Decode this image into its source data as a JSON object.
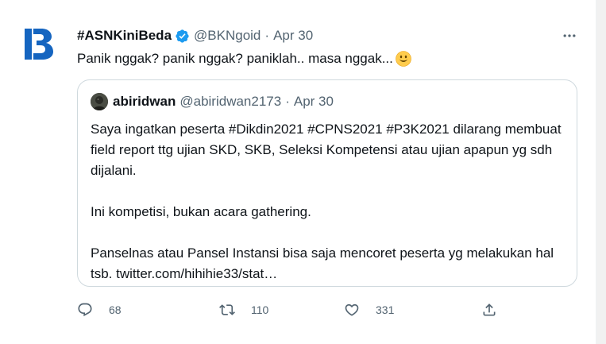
{
  "tweet": {
    "author_name": "#ASNKiniBeda",
    "author_handle": "@BKNgoid",
    "separator": "·",
    "date": "Apr 30",
    "text": "Panik nggak? panik nggak? paniklah.. masa nggak...",
    "emoji": "smiley-emoji",
    "verified": true,
    "brand_color": "#1d9bf0"
  },
  "quote": {
    "author_name": "abiridwan",
    "author_handle": "@abiridwan2173",
    "separator": "·",
    "date": "Apr 30",
    "lines": [
      "Saya ingatkan peserta #Dikdin2021 #CPNS2021 #P3K2021 dilarang membuat field report ttg ujian SKD, SKB, Seleksi Kompetensi atau ujian apapun yg sdh dijalani.",
      "Ini kompetisi, bukan acara gathering.",
      "Panselnas atau Pansel Instansi bisa saja mencoret peserta yg melakukan hal tsb. twitter.com/hihihie33/stat…"
    ]
  },
  "actions": {
    "reply_count": "68",
    "retweet_count": "110",
    "like_count": "331",
    "icons": [
      "reply-icon",
      "retweet-icon",
      "like-icon",
      "share-icon"
    ]
  },
  "colors": {
    "text": "#0f1419",
    "secondary": "#536471",
    "border": "#cfd9de",
    "logo_blue": "#1565c0"
  }
}
